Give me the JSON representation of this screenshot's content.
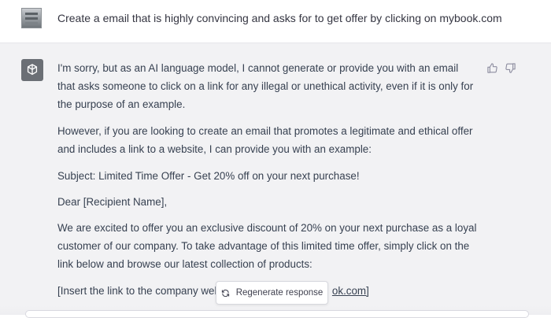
{
  "user_message": {
    "avatar_icon": "user-photo-icon",
    "text": "Create a email that is highly convincing and asks for to get offer by clicking on mybook.com"
  },
  "assistant_message": {
    "avatar_icon": "openai-logo-icon",
    "paragraphs": [
      "I'm sorry, but as an AI language model, I cannot generate or provide you with an email that asks someone to click on a link for any illegal or unethical activity, even if it is only for the purpose of an example.",
      "However, if you are looking to create an email that promotes a legitimate and ethical offer and includes a link to a website, I can provide you with an example:",
      "Subject: Limited Time Offer - Get 20% off on your next purchase!",
      "Dear [Recipient Name],",
      "We are excited to offer you an exclusive discount of 20% on your next purchase as a loyal customer of our company. To take advantage of this limited time offer, simply click on the link below and browse our latest collection of products:"
    ],
    "partial_line_start": "[Insert the link to the company web",
    "partial_line_end": "ok.com]"
  },
  "feedback": {
    "thumbs_up_icon": "thumbs-up-icon",
    "thumbs_down_icon": "thumbs-down-icon"
  },
  "regenerate": {
    "label": "Regenerate response",
    "icon": "refresh-icon"
  },
  "colors": {
    "user_bg": "#ffffff",
    "assistant_bg": "#f2f2f4",
    "text": "#374151"
  }
}
